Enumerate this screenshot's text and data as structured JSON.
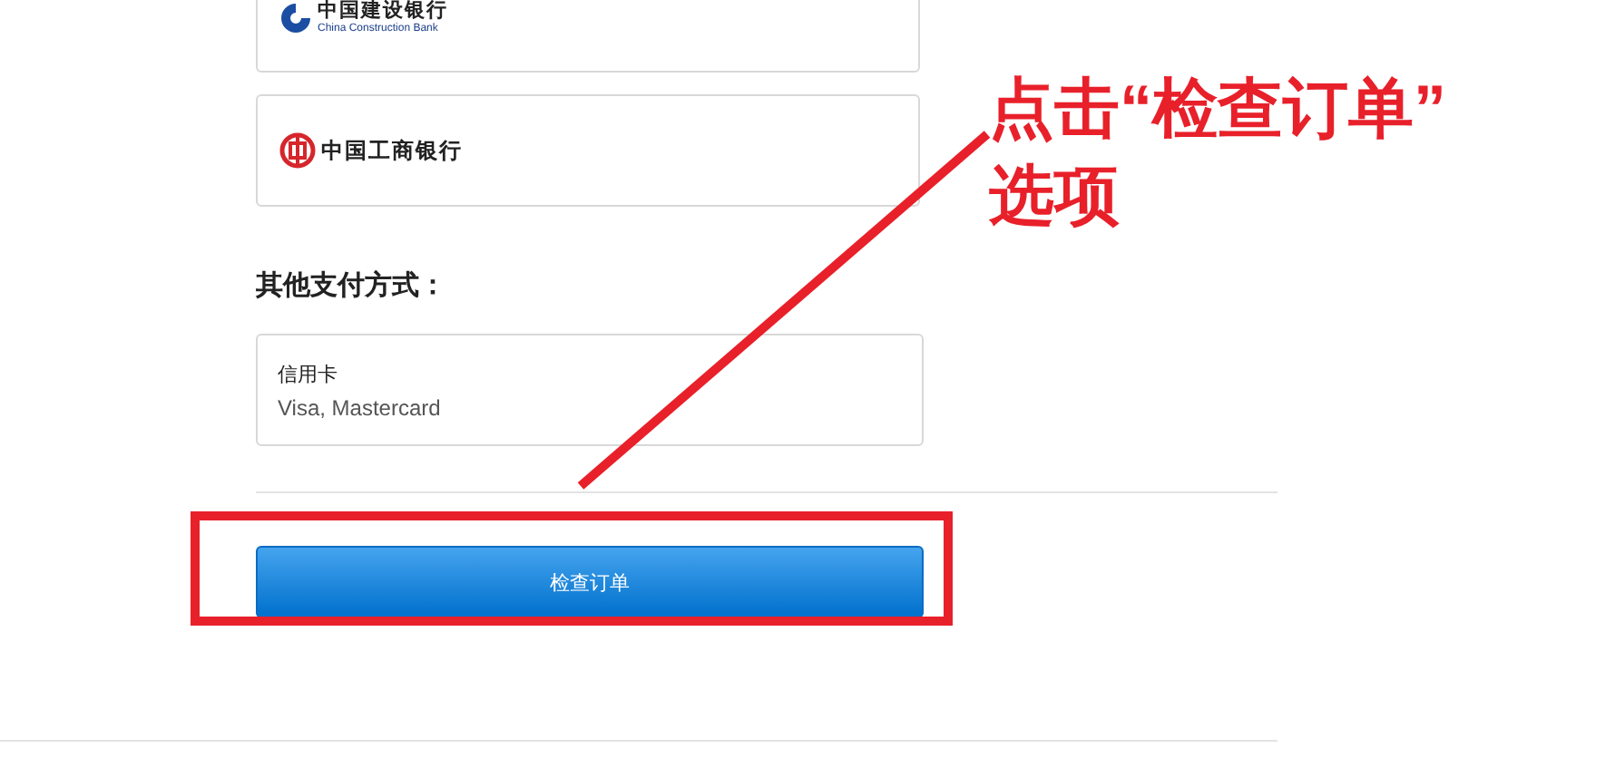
{
  "bank_options": [
    {
      "kind": "ccb",
      "name": "中国建设银行",
      "subtitle": "China Construction Bank"
    },
    {
      "kind": "icbc",
      "name": "中国工商银行"
    }
  ],
  "other_methods": {
    "heading": "其他支付方式：",
    "options": [
      {
        "title": "信用卡",
        "detail": "Visa, Mastercard"
      }
    ]
  },
  "review_button": {
    "label": "检查订单"
  },
  "annotation": {
    "text": "点击“检查订单”",
    "text_2": "选项"
  }
}
